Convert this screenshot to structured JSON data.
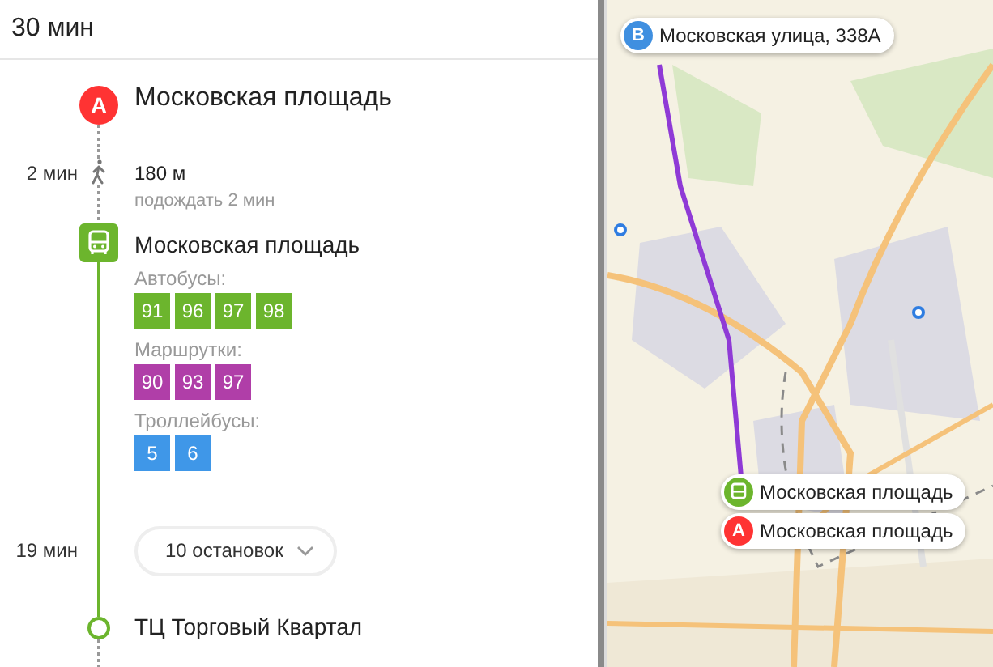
{
  "header": {
    "duration": "30 мин"
  },
  "route": [
    {
      "kind": "start",
      "badge": "A",
      "name": "Московская площадь"
    },
    {
      "kind": "walk",
      "time": "2 мин",
      "distance": "180 м",
      "note": "подождать 2 мин"
    },
    {
      "kind": "board",
      "name": "Московская площадь",
      "groups": [
        {
          "label": "Автобусы:",
          "color": "#6cb52d",
          "routes": [
            "91",
            "96",
            "97",
            "98"
          ]
        },
        {
          "label": "Маршрутки:",
          "color": "#b03ea8",
          "routes": [
            "90",
            "93",
            "97"
          ]
        },
        {
          "label": "Троллейбусы:",
          "color": "#3f97e8",
          "routes": [
            "5",
            "6"
          ]
        }
      ]
    },
    {
      "kind": "ride",
      "time": "19 мин",
      "stops": "10 остановок",
      "expanded": false
    },
    {
      "kind": "end",
      "name": "ТЦ Торговый Квартал"
    }
  ],
  "map": {
    "kind": "picture",
    "pins": [
      {
        "kind": "b",
        "badge": "B",
        "label": "Московская улица, 338А"
      },
      {
        "kind": "bus",
        "label": "Московская площадь"
      },
      {
        "kind": "a",
        "badge": "A",
        "label": "Московская площадь"
      }
    ]
  }
}
